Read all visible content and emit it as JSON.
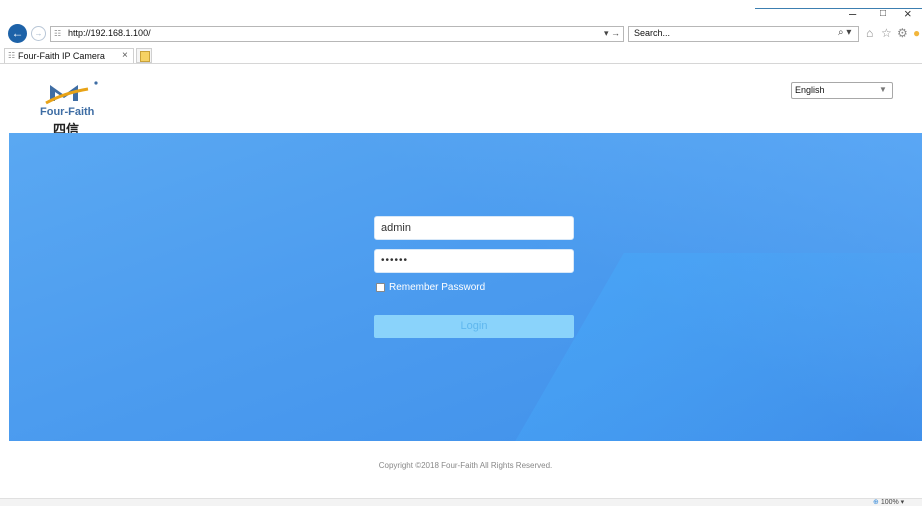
{
  "browser": {
    "url": "http://192.168.1.100/",
    "go_arrows": "▾ →",
    "search_placeholder": "Search...",
    "tab_title": "Four-Faith IP Camera",
    "tab_close": "×",
    "window_controls": {
      "minimize": "–",
      "restore": "□",
      "close": "×"
    },
    "zoom": "100%",
    "icons": {
      "back": "back-arrow-icon",
      "forward": "forward-arrow-icon",
      "home": "home-icon",
      "favorites": "star-icon",
      "settings": "gear-icon"
    }
  },
  "header": {
    "logo_text": "Four-Faith",
    "logo_cn": "四信",
    "language": "English"
  },
  "login": {
    "username": "admin",
    "password_mask": "••••••",
    "remember_label": "Remember Password",
    "remember_checked": false,
    "login_label": "Login"
  },
  "footer": {
    "copyright": "Copyright ©2018 Four-Faith All Rights Reserved."
  },
  "colors": {
    "banner": "#4c9cef",
    "login_button": "#8ad3fb",
    "logo_blue": "#3e6da4"
  }
}
